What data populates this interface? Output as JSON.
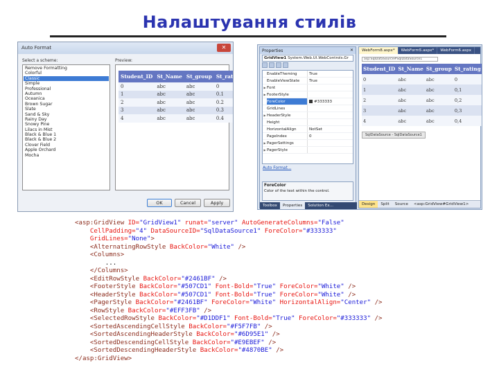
{
  "slide": {
    "title": "Налаштування стилів"
  },
  "autoformat_dialog": {
    "title": "Auto Format",
    "close_glyph": "✕",
    "select_label": "Select a scheme:",
    "preview_label": "Preview:",
    "schemes": [
      "Remove Formatting",
      "Colorful",
      "Classic",
      "Simple",
      "Professional",
      "Autumn",
      "Oceanica",
      "Brown Sugar",
      "Slate",
      "Sand & Sky",
      "Rainy Day",
      "Snowy Pine",
      "Lilacs in Mist",
      "Black & Blue 1",
      "Black & Blue 2",
      "Clover Field",
      "Apple Orchard",
      "Mocha"
    ],
    "selected_index": 2,
    "preview": {
      "columns": [
        "Student_ID",
        "St_Name",
        "St_group",
        "St_rating"
      ],
      "rows": [
        [
          "0",
          "abc",
          "abc",
          "0"
        ],
        [
          "1",
          "abc",
          "abc",
          "0.1"
        ],
        [
          "2",
          "abc",
          "abc",
          "0.2"
        ],
        [
          "3",
          "abc",
          "abc",
          "0.3"
        ],
        [
          "4",
          "abc",
          "abc",
          "0.4"
        ]
      ]
    },
    "buttons": {
      "ok": "OK",
      "cancel": "Cancel",
      "apply": "Apply"
    }
  },
  "ide": {
    "properties": {
      "title": "Properties",
      "close_glyph": "✕",
      "object_name": "GridView1",
      "object_type": "System.Web.UI.WebControls.Gr",
      "rows": [
        {
          "name": "EnableTheming",
          "value": "True",
          "expand": ""
        },
        {
          "name": "EnableViewState",
          "value": "True",
          "expand": ""
        },
        {
          "name": "Font",
          "value": "",
          "expand": "▶"
        },
        {
          "name": "FooterStyle",
          "value": "",
          "expand": "▶"
        },
        {
          "name": "ForeColor",
          "value": "#333333",
          "expand": ""
        },
        {
          "name": "GridLines",
          "value": "",
          "expand": ""
        },
        {
          "name": "HeaderStyle",
          "value": "",
          "expand": "▶"
        },
        {
          "name": "Height",
          "value": "",
          "expand": ""
        },
        {
          "name": "HorizontalAlign",
          "value": "NotSet",
          "expand": ""
        },
        {
          "name": "PageIndex",
          "value": "0",
          "expand": ""
        },
        {
          "name": "PagerSettings",
          "value": "",
          "expand": "▶"
        },
        {
          "name": "PagerStyle",
          "value": "",
          "expand": "▶"
        }
      ],
      "selected_row": 4,
      "link": "Auto Format...",
      "desc_name": "ForeColor",
      "desc_text": "Color of the text within the control.",
      "tabs": [
        "Toolbox",
        "Properties",
        "Solution Ex..."
      ],
      "active_tab": 1
    },
    "designer": {
      "tabs": [
        "WebForm8.aspx*",
        "WebForm5.aspx*",
        "WebForm6.aspx"
      ],
      "active_tab": 0,
      "datasource_combo": "asp:SqlDataSource#SqlDataSource1",
      "grid": {
        "columns": [
          "Student_ID",
          "St_Name",
          "St_group",
          "St_rating"
        ],
        "rows": [
          [
            "0",
            "abc",
            "abc",
            "0"
          ],
          [
            "1",
            "abc",
            "abc",
            "0,1"
          ],
          [
            "2",
            "abc",
            "abc",
            "0,2"
          ],
          [
            "3",
            "abc",
            "abc",
            "0,3"
          ],
          [
            "4",
            "abc",
            "abc",
            "0,4"
          ]
        ]
      },
      "datasource_tag": "SqlDataSource - SqlDataSource1",
      "view_tabs": [
        "Design",
        "Split",
        "Source",
        "<asp:GridView#GridView1>"
      ],
      "active_view": 0
    }
  },
  "code_lines": [
    [
      {
        "t": "tag",
        "s": "<asp:GridView "
      },
      {
        "t": "attr",
        "s": "ID="
      },
      {
        "t": "val",
        "s": "\"GridView1\" "
      },
      {
        "t": "attr",
        "s": "runat="
      },
      {
        "t": "val",
        "s": "\"server\" "
      },
      {
        "t": "attr",
        "s": "AutoGenerateColumns="
      },
      {
        "t": "val",
        "s": "\"False\""
      }
    ],
    [
      {
        "t": "txt",
        "s": "    "
      },
      {
        "t": "attr",
        "s": "CellPadding="
      },
      {
        "t": "val",
        "s": "\"4\" "
      },
      {
        "t": "attr",
        "s": "DataSourceID="
      },
      {
        "t": "val",
        "s": "\"SqlDataSource1\" "
      },
      {
        "t": "attr",
        "s": "ForeColor="
      },
      {
        "t": "val",
        "s": "\"#333333\""
      }
    ],
    [
      {
        "t": "txt",
        "s": "    "
      },
      {
        "t": "attr",
        "s": "GridLines="
      },
      {
        "t": "val",
        "s": "\"None\""
      },
      {
        "t": "tag",
        "s": ">"
      }
    ],
    [
      {
        "t": "txt",
        "s": "    "
      },
      {
        "t": "tag",
        "s": "<AlternatingRowStyle "
      },
      {
        "t": "attr",
        "s": "BackColor="
      },
      {
        "t": "val",
        "s": "\"White\" "
      },
      {
        "t": "tag",
        "s": "/>"
      }
    ],
    [
      {
        "t": "txt",
        "s": "    "
      },
      {
        "t": "tag",
        "s": "<Columns>"
      }
    ],
    [
      {
        "t": "txt",
        "s": "        ..."
      }
    ],
    [
      {
        "t": "txt",
        "s": "    "
      },
      {
        "t": "tag",
        "s": "</Columns>"
      }
    ],
    [
      {
        "t": "txt",
        "s": "    "
      },
      {
        "t": "tag",
        "s": "<EditRowStyle "
      },
      {
        "t": "attr",
        "s": "BackColor="
      },
      {
        "t": "val",
        "s": "\"#2461BF\" "
      },
      {
        "t": "tag",
        "s": "/>"
      }
    ],
    [
      {
        "t": "txt",
        "s": "    "
      },
      {
        "t": "tag",
        "s": "<FooterStyle "
      },
      {
        "t": "attr",
        "s": "BackColor="
      },
      {
        "t": "val",
        "s": "\"#507CD1\" "
      },
      {
        "t": "attr",
        "s": "Font-Bold="
      },
      {
        "t": "val",
        "s": "\"True\" "
      },
      {
        "t": "attr",
        "s": "ForeColor="
      },
      {
        "t": "val",
        "s": "\"White\" "
      },
      {
        "t": "tag",
        "s": "/>"
      }
    ],
    [
      {
        "t": "txt",
        "s": "    "
      },
      {
        "t": "tag",
        "s": "<HeaderStyle "
      },
      {
        "t": "attr",
        "s": "BackColor="
      },
      {
        "t": "val",
        "s": "\"#507CD1\" "
      },
      {
        "t": "attr",
        "s": "Font-Bold="
      },
      {
        "t": "val",
        "s": "\"True\" "
      },
      {
        "t": "attr",
        "s": "ForeColor="
      },
      {
        "t": "val",
        "s": "\"White\" "
      },
      {
        "t": "tag",
        "s": "/>"
      }
    ],
    [
      {
        "t": "txt",
        "s": "    "
      },
      {
        "t": "tag",
        "s": "<PagerStyle "
      },
      {
        "t": "attr",
        "s": "BackColor="
      },
      {
        "t": "val",
        "s": "\"#2461BF\" "
      },
      {
        "t": "attr",
        "s": "ForeColor="
      },
      {
        "t": "val",
        "s": "\"White\" "
      },
      {
        "t": "attr",
        "s": "HorizontalAlign="
      },
      {
        "t": "val",
        "s": "\"Center\" "
      },
      {
        "t": "tag",
        "s": "/>"
      }
    ],
    [
      {
        "t": "txt",
        "s": "    "
      },
      {
        "t": "tag",
        "s": "<RowStyle "
      },
      {
        "t": "attr",
        "s": "BackColor="
      },
      {
        "t": "val",
        "s": "\"#EFF3FB\" "
      },
      {
        "t": "tag",
        "s": "/>"
      }
    ],
    [
      {
        "t": "txt",
        "s": "    "
      },
      {
        "t": "tag",
        "s": "<SelectedRowStyle "
      },
      {
        "t": "attr",
        "s": "BackColor="
      },
      {
        "t": "val",
        "s": "\"#D1DDF1\" "
      },
      {
        "t": "attr",
        "s": "Font-Bold="
      },
      {
        "t": "val",
        "s": "\"True\" "
      },
      {
        "t": "attr",
        "s": "ForeColor="
      },
      {
        "t": "val",
        "s": "\"#333333\" "
      },
      {
        "t": "tag",
        "s": "/>"
      }
    ],
    [
      {
        "t": "txt",
        "s": "    "
      },
      {
        "t": "tag",
        "s": "<SortedAscendingCellStyle "
      },
      {
        "t": "attr",
        "s": "BackColor="
      },
      {
        "t": "val",
        "s": "\"#F5F7FB\" "
      },
      {
        "t": "tag",
        "s": "/>"
      }
    ],
    [
      {
        "t": "txt",
        "s": "    "
      },
      {
        "t": "tag",
        "s": "<SortedAscendingHeaderStyle "
      },
      {
        "t": "attr",
        "s": "BackColor="
      },
      {
        "t": "val",
        "s": "\"#6D95E1\" "
      },
      {
        "t": "tag",
        "s": "/>"
      }
    ],
    [
      {
        "t": "txt",
        "s": "    "
      },
      {
        "t": "tag",
        "s": "<SortedDescendingCellStyle "
      },
      {
        "t": "attr",
        "s": "BackColor="
      },
      {
        "t": "val",
        "s": "\"#E9EBEF\" "
      },
      {
        "t": "tag",
        "s": "/>"
      }
    ],
    [
      {
        "t": "txt",
        "s": "    "
      },
      {
        "t": "tag",
        "s": "<SortedDescendingHeaderStyle "
      },
      {
        "t": "attr",
        "s": "BackColor="
      },
      {
        "t": "val",
        "s": "\"#4870BE\" "
      },
      {
        "t": "tag",
        "s": "/>"
      }
    ],
    [
      {
        "t": "tag",
        "s": "</asp:GridView>"
      }
    ]
  ]
}
